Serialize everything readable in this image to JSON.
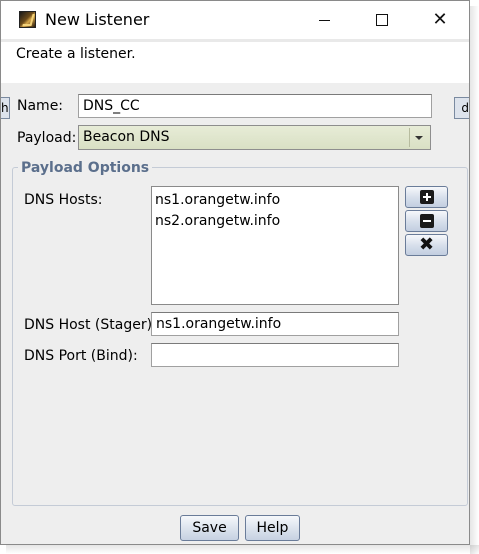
{
  "window": {
    "title": "New Listener",
    "app_icon": "cobalt-strike-icon",
    "controls": {
      "minimize_icon": "minimize-icon",
      "maximize_icon": "maximize-icon",
      "close_icon": "close-icon",
      "close_glyph": "✕"
    }
  },
  "description": "Create a listener.",
  "background": {
    "left_glimpse": "h",
    "right_glimpse": "d"
  },
  "form": {
    "name": {
      "label": "Name:",
      "value": "DNS_CC"
    },
    "payload": {
      "label": "Payload:",
      "selected": "Beacon DNS"
    }
  },
  "payload_options": {
    "title": "Payload Options",
    "dns_hosts": {
      "label": "DNS Hosts:",
      "items": [
        "ns1.orangetw.info",
        "ns2.orangetw.info"
      ],
      "buttons": {
        "add_icon": "plus-icon",
        "remove_icon": "minus-icon",
        "clear_icon": "x-icon",
        "clear_glyph": "✖"
      }
    },
    "dns_host_stager": {
      "label": "DNS Host (Stager):",
      "value": "ns1.orangetw.info"
    },
    "dns_port_bind": {
      "label": "DNS Port (Bind):",
      "value": ""
    }
  },
  "buttons": {
    "save": "Save",
    "help": "Help"
  },
  "colors": {
    "window_bg": "#eeeeee",
    "select_bg": "#dfe5cd",
    "group_title": "#5b6f8c",
    "button_border": "#6a7c99"
  }
}
